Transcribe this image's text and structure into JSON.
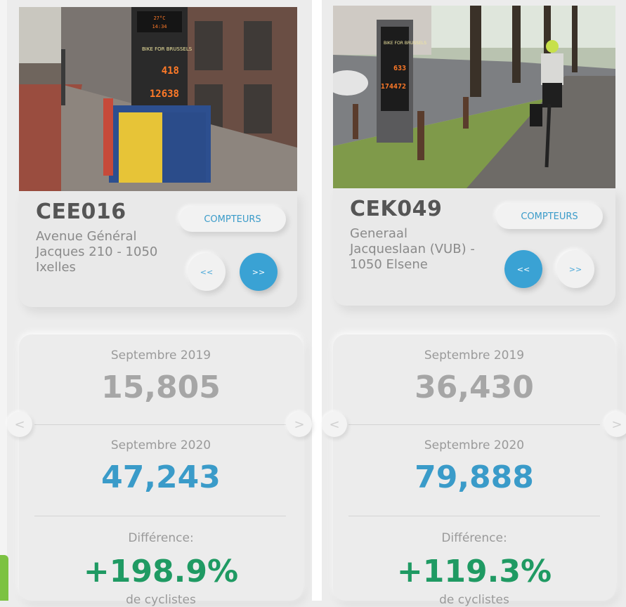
{
  "counters": [
    {
      "code": "CEE016",
      "address": "Avenue Général Jacques 210 - 1050 Ixelles",
      "compteurs_label": "COMPTEURS",
      "prev_label": "<<",
      "next_label": ">>",
      "active_nav": "next",
      "display": {
        "temperature": "27°C",
        "time": "14:34",
        "brand": "BIKE FOR BRUSSELS",
        "daily_count": "418",
        "year_count": "12638"
      },
      "stats": {
        "before_label": "Septembre 2019",
        "before_value": "15,805",
        "after_label": "Septembre 2020",
        "after_value": "47,243",
        "diff_label": "Différence:",
        "diff_value": "+198.9%",
        "diff_unit": "de cyclistes"
      }
    },
    {
      "code": "CEK049",
      "address": "Generaal Jacqueslaan (VUB) - 1050 Elsene",
      "compteurs_label": "COMPTEURS",
      "prev_label": "<<",
      "next_label": ">>",
      "active_nav": "prev",
      "display": {
        "brand": "BIKE FOR BRUSSELS",
        "daily_count": "633",
        "year_count": "174472"
      },
      "stats": {
        "before_label": "Septembre 2019",
        "before_value": "36,430",
        "after_label": "Septembre 2020",
        "after_value": "79,888",
        "diff_label": "Différence:",
        "diff_value": "+119.3%",
        "diff_unit": "de cyclistes"
      }
    }
  ],
  "carousel": {
    "left_arrow": "<",
    "right_arrow": ">"
  },
  "colors": {
    "accent_blue": "#3aa2d4",
    "value_blue": "#3a9bc9",
    "diff_green": "#1f9a63",
    "brand_green": "#7cc242"
  }
}
